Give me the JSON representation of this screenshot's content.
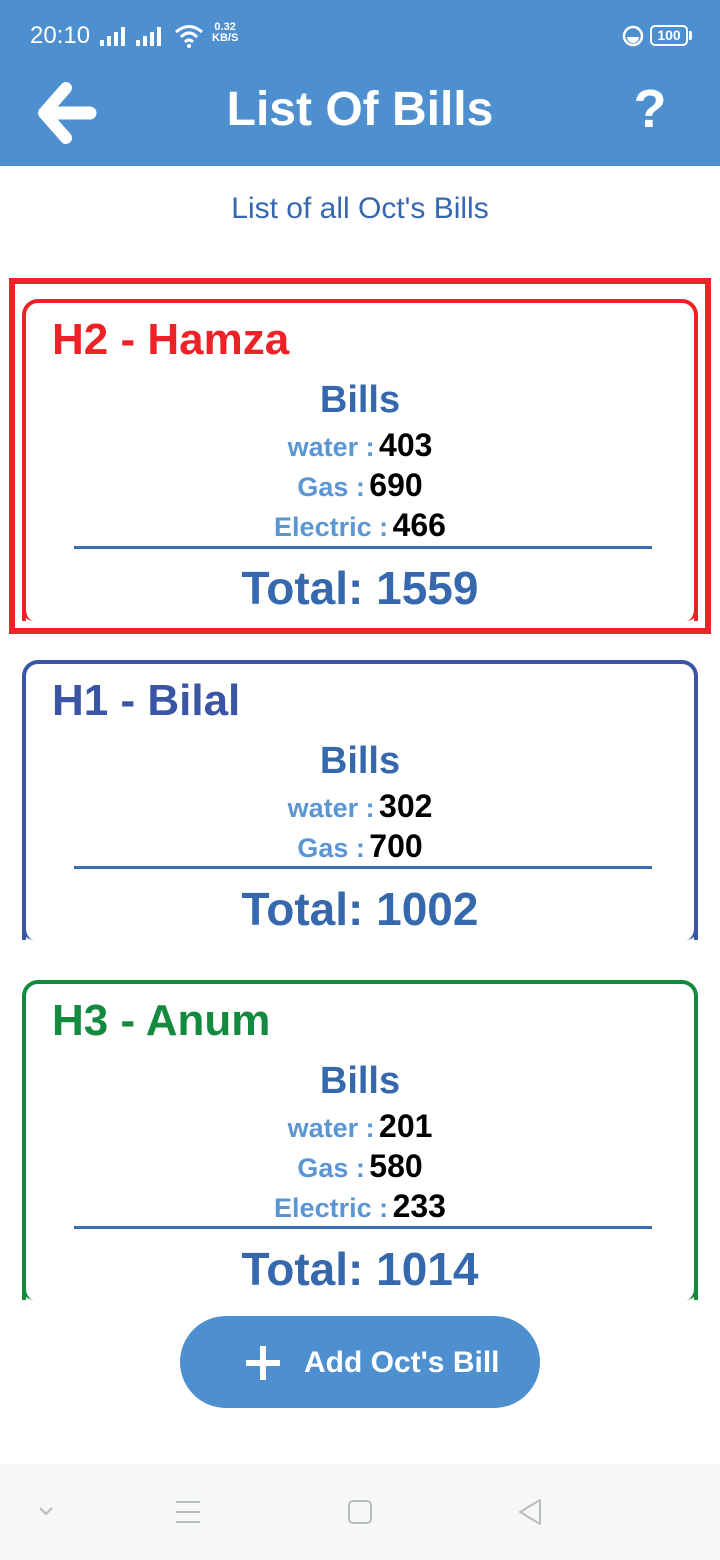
{
  "status_bar": {
    "time": "20:10",
    "speed_value": "0.32",
    "speed_unit": "KB/S",
    "battery": "100"
  },
  "app_bar": {
    "back_icon": "arrow-left-icon",
    "title": "List Of Bills",
    "help_label": "?"
  },
  "subtitle": "List of all Oct's Bills",
  "bills_heading": "Bills",
  "total_prefix": "Total: ",
  "cards": [
    {
      "name": "H2 - Hamza",
      "color": "#ec2227",
      "highlighted": true,
      "items": [
        {
          "label": "water :",
          "value": "403"
        },
        {
          "label": "Gas :",
          "value": "690"
        },
        {
          "label": "Electric :",
          "value": "466"
        }
      ],
      "total": "1559"
    },
    {
      "name": "H1 - Bilal",
      "color": "#3a55a4",
      "highlighted": false,
      "items": [
        {
          "label": "water :",
          "value": "302"
        },
        {
          "label": "Gas :",
          "value": "700"
        }
      ],
      "total": "1002"
    },
    {
      "name": "H3 - Anum",
      "color": "#148a3f",
      "highlighted": false,
      "items": [
        {
          "label": "water :",
          "value": "201"
        },
        {
          "label": "Gas :",
          "value": "580"
        },
        {
          "label": "Electric :",
          "value": "233"
        }
      ],
      "total": "1014"
    }
  ],
  "add_button": {
    "label": "Add Oct's Bill",
    "icon": "plus-icon"
  },
  "colors": {
    "primary": "#4e8fd0",
    "text_blue": "#3668ad",
    "label_blue": "#5b96d3",
    "highlight_red": "#ec2227"
  },
  "nav_bar": {
    "items": [
      "chevron-down-icon",
      "menu-icon",
      "home-square-icon",
      "back-triangle-icon"
    ]
  }
}
